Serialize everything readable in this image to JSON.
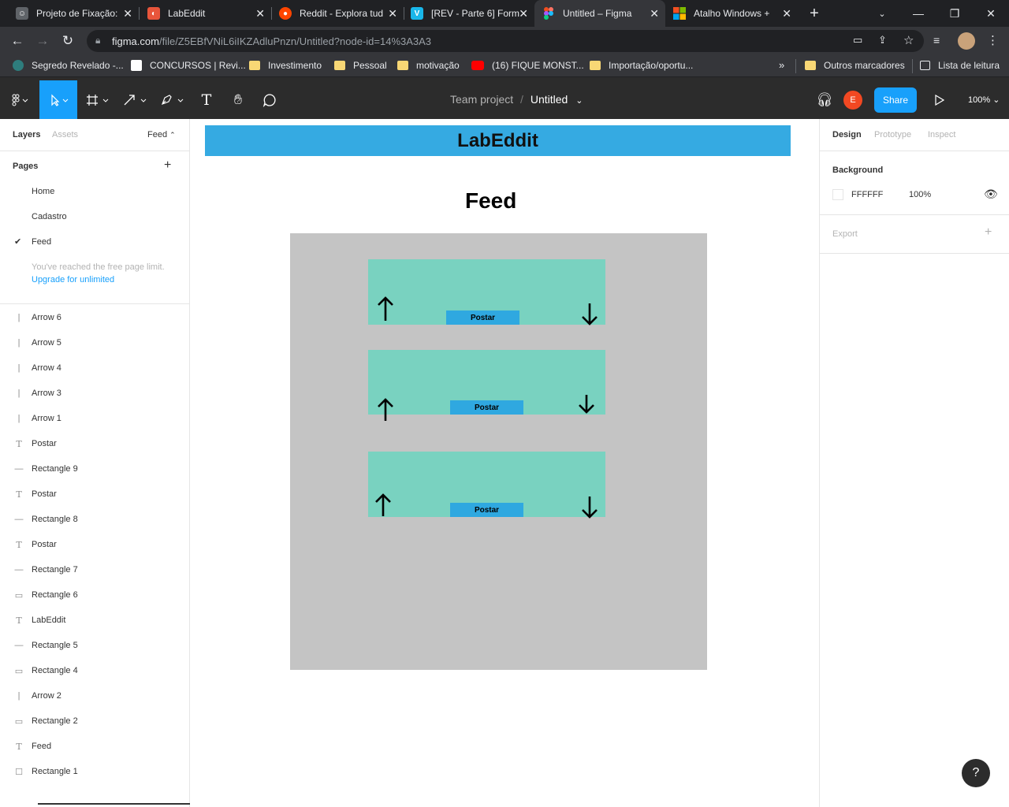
{
  "browser": {
    "tabs": [
      {
        "title": "Projeto de Fixação:",
        "icon": "robot-icon",
        "color": "#8ab4f8"
      },
      {
        "title": "LabEddit",
        "icon": "labeddit-icon",
        "color": "#e8553b"
      },
      {
        "title": "Reddit - Explora tud",
        "icon": "reddit-icon",
        "color": "#ff4500"
      },
      {
        "title": "[REV - Parte 6] Form",
        "icon": "vimeo-icon",
        "color": "#19b7ea"
      },
      {
        "title": "Untitled – Figma",
        "icon": "figma-icon",
        "color": "#a259ff"
      },
      {
        "title": "Atalho Windows +",
        "icon": "microsoft-icon",
        "color": "#f25022"
      }
    ],
    "url_host": "figma.com",
    "url_path": "/file/Z5EBfVNiL6iIKZAdluPnzn/Untitled?node-id=14%3A3A3",
    "bookmarks": [
      {
        "label": "Segredo Revelado -...",
        "icon": "s-icon"
      },
      {
        "label": "CONCURSOS | Revi...",
        "icon": "z-icon"
      },
      {
        "label": "Investimento",
        "icon": "folder-icon"
      },
      {
        "label": "Pessoal",
        "icon": "folder-icon"
      },
      {
        "label": "motivação",
        "icon": "folder-icon"
      },
      {
        "label": "(16) FIQUE MONST...",
        "icon": "youtube-icon"
      },
      {
        "label": "Importação/oportu...",
        "icon": "folder-icon"
      }
    ],
    "other_bookmarks": "Outros marcadores",
    "reading_list": "Lista de leitura"
  },
  "figma": {
    "project": "Team project",
    "file": "Untitled",
    "separator": "/",
    "avatar_letter": "E",
    "share_label": "Share",
    "zoom": "100%",
    "left_tabs": {
      "layers": "Layers",
      "assets": "Assets",
      "page": "Feed"
    },
    "pages_title": "Pages",
    "pages": [
      "Home",
      "Cadastro",
      "Feed"
    ],
    "active_page": "Feed",
    "page_limit_note": "You've reached the free page limit.",
    "upgrade_link": "Upgrade for unlimited",
    "layers": [
      {
        "name": "Arrow 6",
        "type": "arrow"
      },
      {
        "name": "Arrow 5",
        "type": "arrow"
      },
      {
        "name": "Arrow 4",
        "type": "arrow"
      },
      {
        "name": "Arrow 3",
        "type": "arrow"
      },
      {
        "name": "Arrow 1",
        "type": "arrow"
      },
      {
        "name": "Postar",
        "type": "text"
      },
      {
        "name": "Rectangle 9",
        "type": "line"
      },
      {
        "name": "Postar",
        "type": "text"
      },
      {
        "name": "Rectangle 8",
        "type": "line"
      },
      {
        "name": "Postar",
        "type": "text"
      },
      {
        "name": "Rectangle 7",
        "type": "line"
      },
      {
        "name": "Rectangle 6",
        "type": "rect"
      },
      {
        "name": "LabEddit",
        "type": "text"
      },
      {
        "name": "Rectangle 5",
        "type": "line"
      },
      {
        "name": "Rectangle 4",
        "type": "rect"
      },
      {
        "name": "Arrow 2",
        "type": "arrow"
      },
      {
        "name": "Rectangle 2",
        "type": "rect"
      },
      {
        "name": "Feed",
        "type": "text"
      },
      {
        "name": "Rectangle 1",
        "type": "square"
      }
    ],
    "right_tabs": {
      "design": "Design",
      "prototype": "Prototype",
      "inspect": "Inspect"
    },
    "background_label": "Background",
    "background_hex": "FFFFFF",
    "background_opacity": "100%",
    "export_label": "Export",
    "help": "?"
  },
  "canvas": {
    "header_title": "LabEddit",
    "feed_title": "Feed",
    "post_button": "Postar",
    "colors": {
      "header": "#35aae2",
      "frame": "#c4c4c4",
      "post": "#79d2c0",
      "button": "#2fa8e0"
    }
  }
}
